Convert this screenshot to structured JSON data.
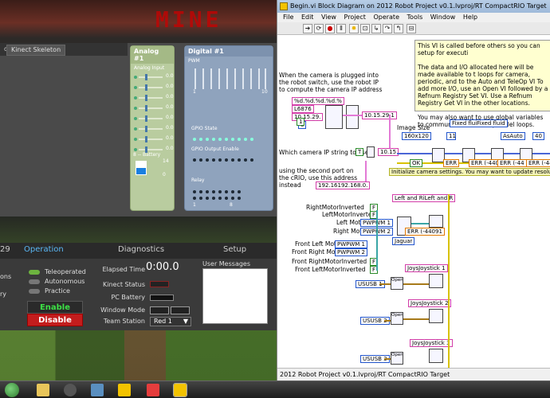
{
  "game": {
    "logo": "MINE"
  },
  "dashboard": {
    "tabs": {
      "kinect_skeleton": "Kinect Skeleton",
      "left_cut": "d"
    },
    "analog": {
      "title": "Analog #1",
      "input_label": "Analog Input",
      "rows": [
        {
          "val": "0.0"
        },
        {
          "val": "0.0"
        },
        {
          "val": "0.0"
        },
        {
          "val": "0.0"
        },
        {
          "val": "0.0"
        },
        {
          "val": "0.0"
        },
        {
          "val": "0.0"
        },
        {
          "val": "0.0"
        }
      ],
      "battery_label": "8 -- Battery",
      "battery_max": "14",
      "battery_min": "0",
      "battery_level": 0.5
    },
    "digital": {
      "title": "Digital #1",
      "pwm_label": "PWM",
      "pwm_min": "1",
      "pwm_max": "10",
      "gpio_state_label": "GPIO State",
      "gpio_output_label": "GPIO Output Enable",
      "relay_label": "Relay",
      "relay_min": "1",
      "relay_max": "8"
    },
    "nav": {
      "left_num": "29",
      "operation": "Operation",
      "diagnostics": "Diagnostics",
      "setup": "Setup"
    },
    "modes": [
      {
        "label": "Teleoperated",
        "active": true
      },
      {
        "label": "Autonomous",
        "active": false
      },
      {
        "label": "Practice",
        "active": false
      }
    ],
    "left_cut_text": {
      "line1": "ons",
      "line2": "ry"
    },
    "enable_label": "Enable",
    "disable_label": "Disable",
    "info": {
      "elapsed_label": "Elapsed Time",
      "elapsed_value": "0:00.0",
      "kinect_label": "Kinect Status",
      "pc_battery_label": "PC Battery",
      "window_mode_label": "Window Mode",
      "team_station_label": "Team Station",
      "team_station_value": "Red 1"
    },
    "user_messages_label": "User Messages"
  },
  "labview": {
    "title": "Begin.vi Block Diagram on 2012 Robot Project v0.1.lvproj/RT CompactRIO Target",
    "menu": [
      "File",
      "Edit",
      "View",
      "Project",
      "Operate",
      "Tools",
      "Window",
      "Help"
    ],
    "status": "2012 Robot Project v0.1.lvproj/RT CompactRIO Target",
    "comment_top": "This VI is called before others so you can setup for executi\n\nThe data and I/O allocated here will be made available to t loops for camera, periodic, and to the Auto and TeleOp VI To add more I/O, use an Open VI followed by a Refnum Registry Set VI. Use a Refnum Registry Get VI in the other locations.\n\nYou may also want to use global variables to communicat between parallel loops.",
    "comment_camera": "When the camera is plugged into the robot switch, use the robot IP to compute the camera IP address",
    "comment_which": "Which camera IP string to use?",
    "comment_second": "using the second port on the cRIO, use this address instead",
    "fmt_string": "%d.%d.%d.%d.%",
    "ip_1": "10.15.29.",
    "ip_2": "10.15.29.1",
    "ip_3": "10.15",
    "ip_alt": "192.16192.168.0.",
    "num_const": "1",
    "num_small": "0",
    "image_size_label": "Image Size",
    "image_size_value": "160x120",
    "fixed_fluid": "Fixed fluiFixed fluid",
    "auto_label": "AsAuto",
    "ok_label": "OK",
    "err_labels": [
      "ERR",
      "ERR (-440",
      "ERR (-44",
      "ERR (-44"
    ],
    "init_banner": "Initialize camera settings. You may want to update resolution, or size",
    "num_40": "40",
    "left_right_label": "Left and RiLeft and R",
    "motor_labels": [
      "RightMotorInverted",
      "LeftMotorInverted",
      "Left Motor",
      "Right Motor",
      "Front Left Motor",
      "Front Right Motor",
      "Front RightMotorInverted",
      "Front LeftMotorInverted"
    ],
    "pwm1": "PWPWM 1",
    "pwm2": "PWPWM 2",
    "err_4409": "ERR (-44091",
    "jaguar": "Jaguar",
    "joystick_1": "JoysJoystick 1",
    "joystick_2": "JoysJoystick 2",
    "joystick_3": "JoysJoystick 3",
    "usb_1": "USUSB 1",
    "usb_2": "USUSB 2",
    "usb_3": "USUSB 3",
    "open_label": "Open",
    "tf_true": "T",
    "tf_false": "F"
  },
  "taskbar": {
    "icons": [
      "explorer-icon",
      "steam-icon",
      "network-icon",
      "labview-icon",
      "frc-icon",
      "driverstation-icon"
    ]
  }
}
